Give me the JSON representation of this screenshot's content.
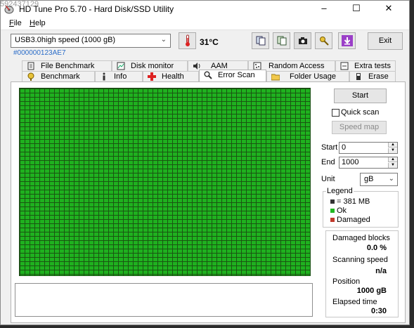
{
  "window": {
    "title": "HD Tune Pro 5.70 - Hard Disk/SSD Utility",
    "controls": {
      "minimize": "–",
      "maximize": "☐",
      "close": "✕"
    }
  },
  "watermark": "592437129",
  "menu": {
    "file": {
      "mnemonic": "F",
      "rest": "ile"
    },
    "help": {
      "mnemonic": "H",
      "rest": "elp"
    }
  },
  "drive": {
    "selected": "USB3.0high speed (1000 gB)",
    "serial": "#000000123AE7"
  },
  "toolbar": {
    "temperature": "31°C",
    "exit_label": "Exit",
    "icons": [
      "thermometer-icon",
      "copy-info-icon",
      "copy-screen-icon",
      "screenshot-icon",
      "options-icon",
      "download-icon"
    ]
  },
  "tabs_top": [
    {
      "label": "File Benchmark",
      "icon": "file-benchmark-icon"
    },
    {
      "label": "Disk monitor",
      "icon": "disk-monitor-icon"
    },
    {
      "label": "AAM",
      "icon": "speaker-icon"
    },
    {
      "label": "Random Access",
      "icon": "random-access-icon"
    },
    {
      "label": "Extra tests",
      "icon": "extra-tests-icon"
    }
  ],
  "tabs_bottom": [
    {
      "label": "Benchmark",
      "icon": "benchmark-icon"
    },
    {
      "label": "Info",
      "icon": "info-icon"
    },
    {
      "label": "Health",
      "icon": "health-icon"
    },
    {
      "label": "Error Scan",
      "icon": "magnifier-icon",
      "active": true
    },
    {
      "label": "Folder Usage",
      "icon": "folder-icon"
    },
    {
      "label": "Erase",
      "icon": "erase-icon"
    }
  ],
  "scan": {
    "start_label": "Start",
    "quick_scan_label": "Quick scan",
    "quick_scan_checked": false,
    "speed_map_label": "Speed map",
    "start_field_label": "Start",
    "start_value": "0",
    "end_field_label": "End",
    "end_value": "1000",
    "unit_label": "Unit",
    "unit_value": "gB"
  },
  "legend": {
    "title": "Legend",
    "items": [
      {
        "label": "= 381 MB",
        "color": "#333333"
      },
      {
        "label": "Ok",
        "color": "#22b822"
      },
      {
        "label": "Damaged",
        "color": "#c0392b"
      }
    ]
  },
  "stats": {
    "damaged_blocks_label": "Damaged blocks",
    "damaged_blocks_value": "0.0 %",
    "scanning_speed_label": "Scanning speed",
    "scanning_speed_value": "n/a",
    "position_label": "Position",
    "position_value": "1000 gB",
    "elapsed_label": "Elapsed time",
    "elapsed_value": "0:30"
  },
  "colors": {
    "ok_block": "#1fb11f",
    "grid_line": "#1a5512",
    "serial_link": "#2a6cc8"
  }
}
